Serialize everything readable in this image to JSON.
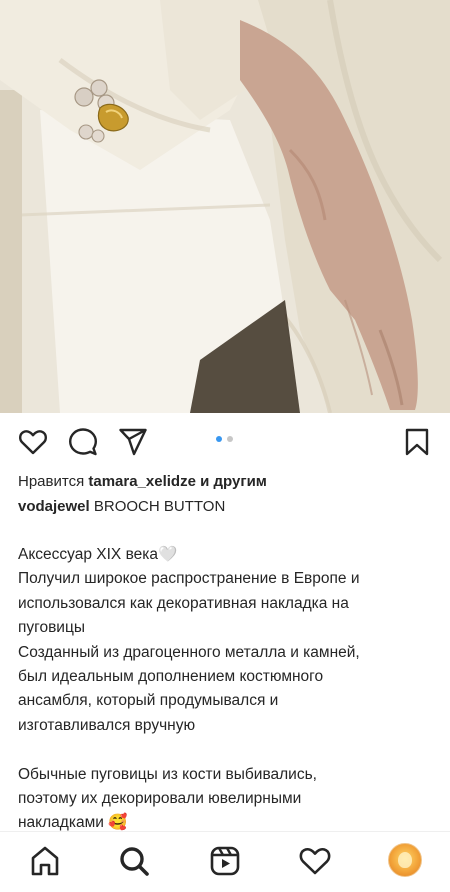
{
  "post": {
    "likes_prefix": "Нравится",
    "likes_user": "tamara_xelidze",
    "likes_suffix": "и другим",
    "author": "vodajewel",
    "title": "BROOCH BUTTON",
    "caption_lines": [
      "Аксессуар XIX века🤍",
      "Получил широкое распространение в Европе и",
      "использовался как декоративная накладка на",
      "пуговицы",
      "Созданный из драгоценного металла и камней,",
      "был идеальным дополнением костюмного",
      "ансамбля, который продумывался и",
      "изготавливался вручную",
      "",
      "Обычные пуговицы из кости выбивались,",
      "поэтому их декорировали ювелирными",
      "накладками 🥰"
    ],
    "carousel": {
      "count": 2,
      "active_index": 0
    }
  },
  "actions": {
    "like_icon": "heart-outline-icon",
    "comment_icon": "comment-icon",
    "share_icon": "paper-plane-icon",
    "save_icon": "bookmark-icon"
  },
  "nav": {
    "items": [
      "home-icon",
      "search-icon",
      "reels-icon",
      "activity-heart-icon",
      "profile-avatar"
    ]
  },
  "colors": {
    "text": "#262626",
    "dot_active": "#3897f0",
    "dot_inactive": "#c7c7c7",
    "photo_bg": "#e9e3d6"
  }
}
